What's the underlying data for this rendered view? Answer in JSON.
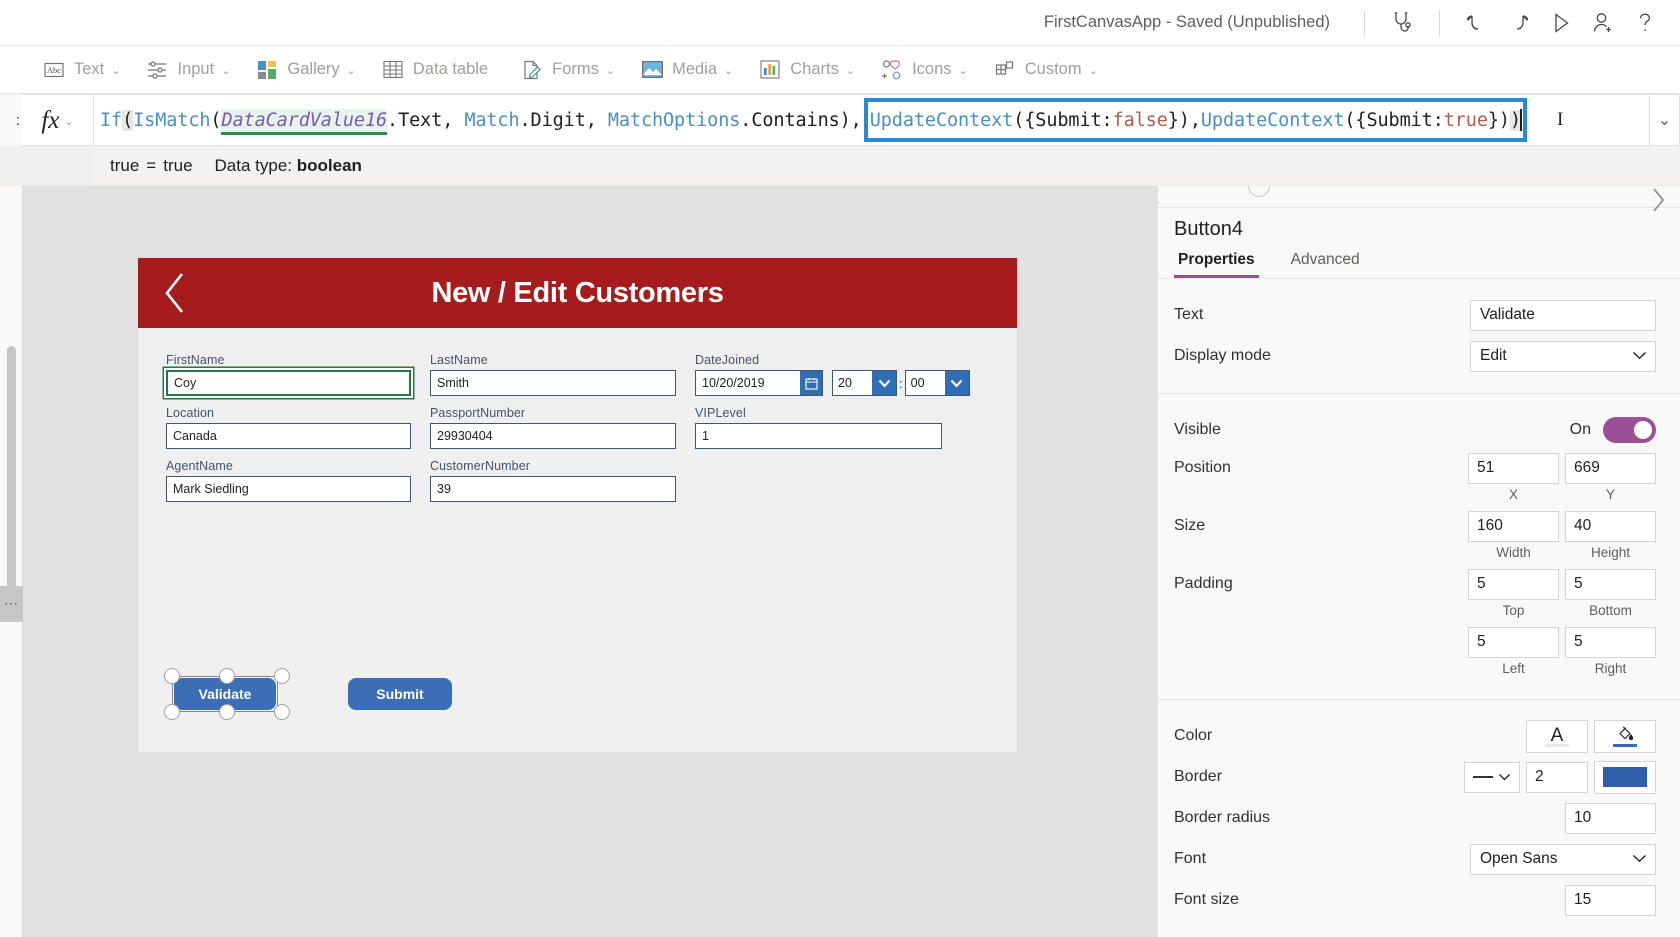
{
  "titlebar": {
    "app_title": "FirstCanvasApp - Saved (Unpublished)",
    "icons": [
      {
        "name": "app-checker-icon",
        "label": "App checker"
      },
      {
        "name": "undo-icon",
        "label": "Undo"
      },
      {
        "name": "redo-icon",
        "label": "Redo"
      },
      {
        "name": "preview-play-icon",
        "label": "Preview the app"
      },
      {
        "name": "share-person-icon",
        "label": "Share"
      },
      {
        "name": "help-question-icon",
        "label": "Help"
      }
    ]
  },
  "ribbon": {
    "items": [
      {
        "label": "Text",
        "icon": "text-abc-icon",
        "caret": "⌄"
      },
      {
        "label": "Input",
        "icon": "input-sliders-icon",
        "caret": "⌄"
      },
      {
        "label": "Gallery",
        "icon": "gallery-squares-icon",
        "caret": "⌄"
      },
      {
        "label": "Data table",
        "icon": "data-table-icon",
        "caret": ""
      },
      {
        "label": "Forms",
        "icon": "forms-pencil-icon",
        "caret": "⌄"
      },
      {
        "label": "Media",
        "icon": "media-picture-icon",
        "caret": "⌄"
      },
      {
        "label": "Charts",
        "icon": "charts-bar-icon",
        "caret": "⌄"
      },
      {
        "label": "Icons",
        "icon": "icons-shapes-icon",
        "caret": "⌄"
      },
      {
        "label": "Custom",
        "icon": "custom-blocks-icon",
        "caret": "⌄"
      }
    ]
  },
  "formula_bar": {
    "property_label": ":",
    "fx_symbol": "fx",
    "fx_caret": "⌄",
    "end_caret": "⌄",
    "full_formula": "If(IsMatch(DataCardValue16.Text, Match.Digit, MatchOptions.Contains), UpdateContext({Submit: false}), UpdateContext({Submit: true}))",
    "tokens_before": [
      {
        "t": "If",
        "c": "tk-fn"
      },
      {
        "t": "(",
        "c": "tk-pun tk-paren-hl"
      },
      {
        "t": "IsMatch",
        "c": "tk-fn"
      },
      {
        "t": "(",
        "c": "tk-pun"
      },
      {
        "t": "DataCardValue16",
        "c": "tk-ctrl"
      },
      {
        "t": ".Text, ",
        "c": "tk-pun"
      },
      {
        "t": "Match",
        "c": "tk-enum"
      },
      {
        "t": ".Digit, ",
        "c": "tk-pun"
      },
      {
        "t": "MatchOptions",
        "c": "tk-enum"
      },
      {
        "t": ".Contains),",
        "c": "tk-pun"
      }
    ],
    "tokens_selected": [
      {
        "t": "UpdateContext",
        "c": "tk-fn"
      },
      {
        "t": "({Submit: ",
        "c": "tk-pun"
      },
      {
        "t": "false",
        "c": "tk-bool"
      },
      {
        "t": "}), ",
        "c": "tk-pun"
      },
      {
        "t": "UpdateContext",
        "c": "tk-fn"
      },
      {
        "t": "({Submit: ",
        "c": "tk-pun"
      },
      {
        "t": "true",
        "c": "tk-bool"
      },
      {
        "t": "})",
        "c": "tk-pun"
      },
      {
        "t": ")",
        "c": "tk-pun tk-paren-hl"
      }
    ]
  },
  "formula_result": {
    "left_value": "true",
    "equals": "=",
    "right_value": "true",
    "datatype_label": "Data type:",
    "datatype_value": "boolean"
  },
  "canvas": {
    "screen_title": "New / Edit Customers",
    "back_icon": "back-chevron-icon",
    "header_color": "#a61b1b",
    "fields": [
      {
        "label": "FirstName",
        "value": "Coy",
        "selected": true,
        "width": "w-sm"
      },
      {
        "label": "LastName",
        "value": "Smith",
        "selected": false,
        "width": "w-md"
      },
      {
        "label": "Location",
        "value": "Canada",
        "selected": false,
        "width": "w-sm"
      },
      {
        "label": "PassportNumber",
        "value": "29930404",
        "selected": false,
        "width": "w-md"
      },
      {
        "label": "VIPLevel",
        "value": "1",
        "selected": false,
        "width": "w-lg"
      },
      {
        "label": "AgentName",
        "value": "Mark Siedling",
        "selected": false,
        "width": "w-sm"
      },
      {
        "label": "CustomerNumber",
        "value": "39",
        "selected": false,
        "width": "w-md"
      }
    ],
    "date_field": {
      "label": "DateJoined",
      "date_value": "10/20/2019",
      "calendar_icon": "calendar-icon",
      "hour_value": "20",
      "minute_value": "00",
      "separator": ":"
    },
    "buttons": {
      "validate_label": "Validate",
      "submit_label": "Submit",
      "fill_color": "#3b6eb5"
    }
  },
  "properties_panel": {
    "control_name": "Button4",
    "collapse_icon": "chevron-right-icon",
    "tabs": [
      {
        "label": "Properties",
        "active": true
      },
      {
        "label": "Advanced",
        "active": false
      }
    ],
    "text": {
      "label": "Text",
      "value": "Validate"
    },
    "display_mode": {
      "label": "Display mode",
      "value": "Edit",
      "caret": "⌄"
    },
    "visible": {
      "label": "Visible",
      "state": "On",
      "on": true
    },
    "position": {
      "label": "Position",
      "x": "51",
      "y": "669",
      "x_sub": "X",
      "y_sub": "Y"
    },
    "size": {
      "label": "Size",
      "width": "160",
      "height": "40",
      "w_sub": "Width",
      "h_sub": "Height"
    },
    "padding": {
      "label": "Padding",
      "top": "5",
      "bottom": "5",
      "left": "5",
      "right": "5",
      "top_sub": "Top",
      "bottom_sub": "Bottom",
      "left_sub": "Left",
      "right_sub": "Right"
    },
    "color": {
      "label": "Color",
      "text_glyph": "A",
      "text_color_underline": "#e6e6e6",
      "fill_icon": "paint-bucket-icon",
      "fill_color_underline": "#2f6eb5"
    },
    "border": {
      "label": "Border",
      "style_icon": "line-style-icon",
      "style_caret": "⌄",
      "thickness": "2",
      "color": "#2f5fa8"
    },
    "border_radius": {
      "label": "Border radius",
      "value": "10"
    },
    "font": {
      "label": "Font",
      "value": "Open Sans",
      "caret": "⌄"
    },
    "font_size": {
      "label": "Font size",
      "value": "15"
    }
  }
}
